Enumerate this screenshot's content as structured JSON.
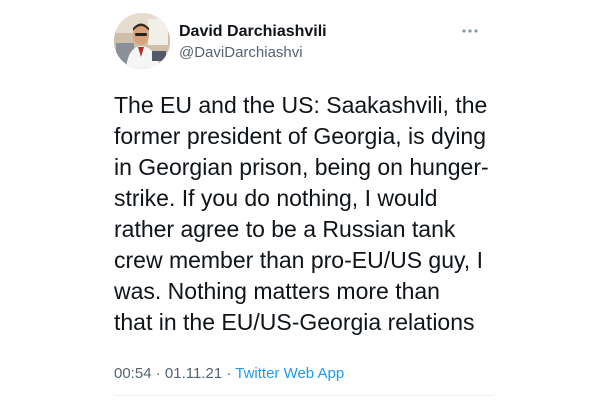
{
  "author": {
    "display_name": "David Darchiashvili",
    "handle": "@DaviDarchiashvi",
    "avatar_icon": "profile-photo",
    "more_icon": "more-horizontal-icon"
  },
  "tweet": {
    "lines": [
      "The EU and the US: Saakashvili, the",
      "former president of Georgia, is dying",
      "in Georgian prison, being on hunger-",
      "strike. If you do nothing, I would",
      "rather agree to be a Russian tank",
      "crew member than pro-EU/US guy, I",
      "was. Nothing matters more than",
      "that in the EU/US-Georgia relations"
    ]
  },
  "meta": {
    "time": "00:54",
    "separator": " · ",
    "date": "01.11.21",
    "source": "Twitter Web App"
  },
  "colors": {
    "text": "#0f1419",
    "secondary": "#536471",
    "link": "#1d9bf0"
  }
}
